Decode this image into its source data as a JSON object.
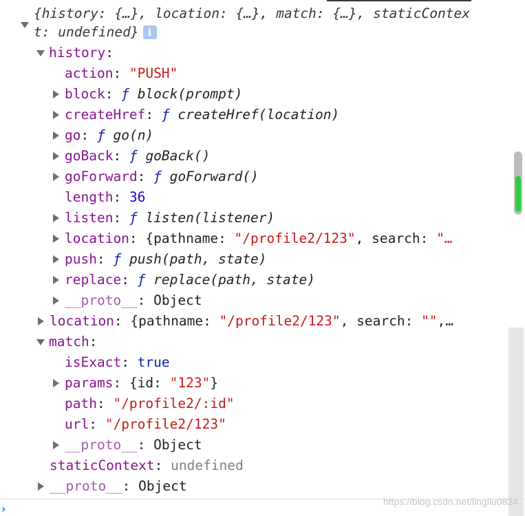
{
  "summary": {
    "text": "{history: {…}, location: {…}, match: {…}, staticContext: undefined}",
    "info_icon": "i"
  },
  "history": {
    "key": "history",
    "action_key": "action",
    "action_value": "\"PUSH\"",
    "block_key": "block",
    "block_f": "ƒ",
    "block_sig": "block(prompt)",
    "createHref_key": "createHref",
    "createHref_f": "ƒ",
    "createHref_sig": "createHref(location)",
    "go_key": "go",
    "go_f": "ƒ",
    "go_sig": "go(n)",
    "goBack_key": "goBack",
    "goBack_f": "ƒ",
    "goBack_sig": "goBack()",
    "goForward_key": "goForward",
    "goForward_f": "ƒ",
    "goForward_sig": "goForward()",
    "length_key": "length",
    "length_value": "36",
    "listen_key": "listen",
    "listen_f": "ƒ",
    "listen_sig": "listen(listener)",
    "location_key": "location",
    "location_pre": "{pathname: ",
    "location_path": "\"/profile2/123\"",
    "location_post": ", search: ",
    "location_tail": "\"…",
    "push_key": "push",
    "push_f": "ƒ",
    "push_sig": "push(path, state)",
    "replace_key": "replace",
    "replace_f": "ƒ",
    "replace_sig": "replace(path, state)",
    "proto_key": "__proto__",
    "proto_value": "Object"
  },
  "location": {
    "key": "location",
    "pre": "{pathname: ",
    "path": "\"/profile2/123\"",
    "post": ", search: ",
    "search_value": "\"\"",
    "tail": ",…"
  },
  "match": {
    "key": "match",
    "isExact_key": "isExact",
    "isExact_value": "true",
    "params_key": "params",
    "params_pre": "{id: ",
    "params_id": "\"123\"",
    "params_post": "}",
    "path_key": "path",
    "path_value": "\"/profile2/:id\"",
    "url_key": "url",
    "url_value": "\"/profile2/123\"",
    "proto_key": "__proto__",
    "proto_value": "Object"
  },
  "staticContext": {
    "key": "staticContext",
    "value": "undefined"
  },
  "root_proto": {
    "key": "__proto__",
    "value": "Object"
  },
  "console": {
    "prompt": "›"
  },
  "watermark": "https://blog.csdn.net/lingliu0824"
}
